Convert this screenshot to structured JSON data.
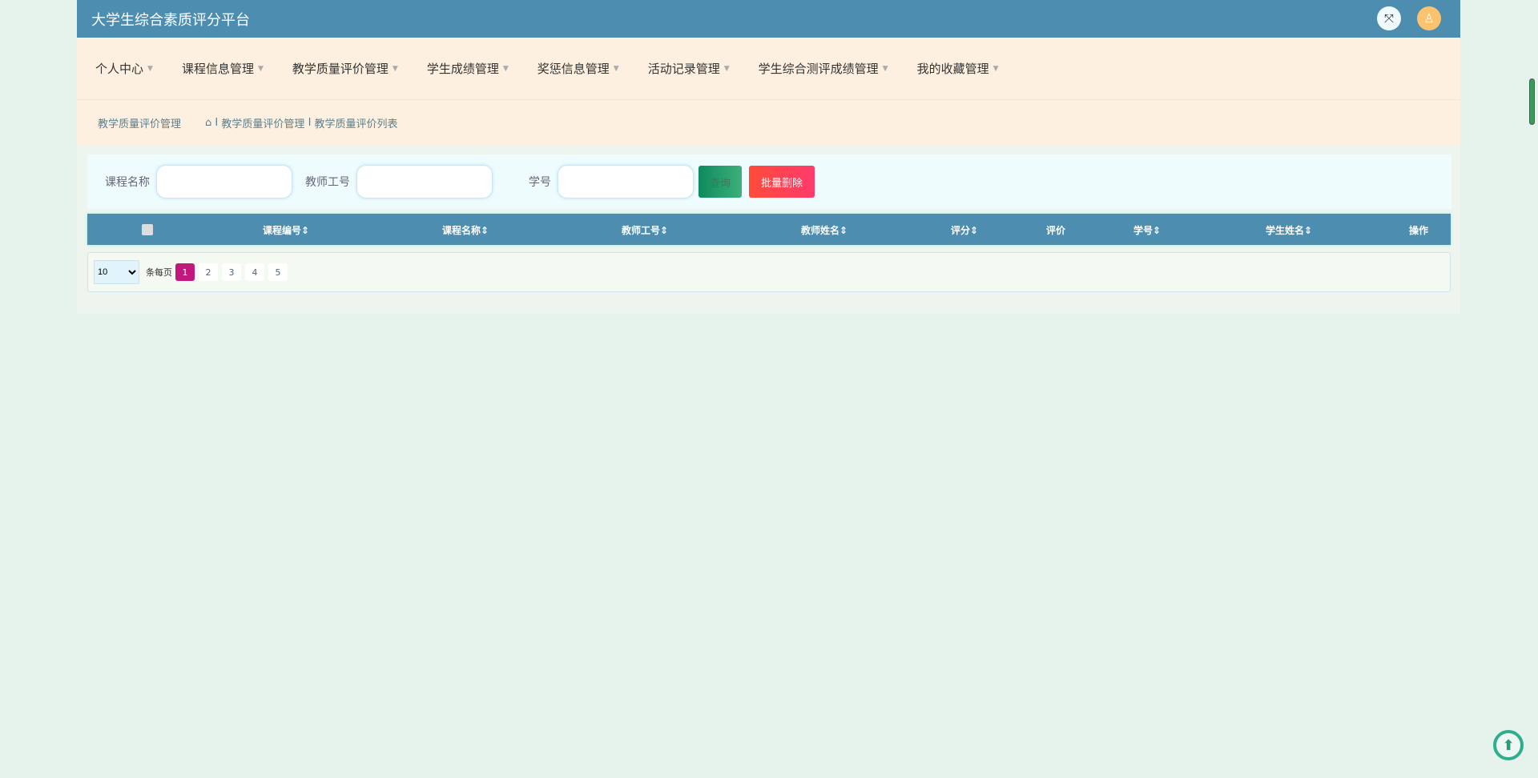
{
  "header": {
    "title": "大学生综合素质评分平台",
    "fullscreen_icon": "expand-icon",
    "avatar_icon": "user-icon"
  },
  "nav": [
    "个人中心",
    "课程信息管理",
    "教学质量评价管理",
    "学生成绩管理",
    "奖惩信息管理",
    "活动记录管理",
    "学生综合测评成绩管理",
    "我的收藏管理"
  ],
  "breadcrumb": {
    "title": "教学质量评价管理",
    "path1": "教学质量评价管理",
    "path2": "教学质量评价列表",
    "sep": "I"
  },
  "search": {
    "f1": "课程名称",
    "f2": "教师工号",
    "f3": "学号",
    "query": "查询",
    "batch_delete": "批量删除"
  },
  "table": {
    "columns": [
      "课程编号",
      "课程名称",
      "教师工号",
      "教师姓名",
      "评分",
      "评价",
      "学号",
      "学生姓名",
      "操作"
    ],
    "sort": "⇕"
  },
  "pager": {
    "size": "10",
    "label": "条每页",
    "pages": [
      "1",
      "2",
      "3",
      "4",
      "5"
    ],
    "current": "1"
  }
}
